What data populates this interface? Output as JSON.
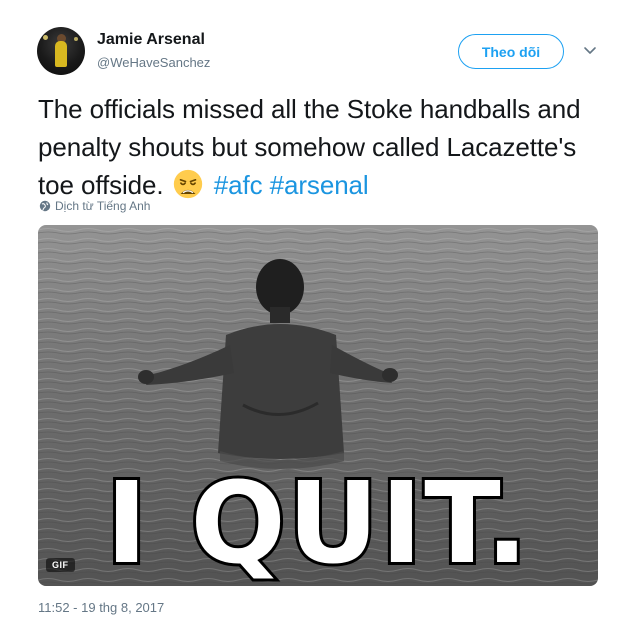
{
  "user": {
    "display_name": "Jamie Arsenal",
    "handle": "@WeHaveSanchez"
  },
  "follow_button": {
    "label": "Theo dõi"
  },
  "tweet": {
    "text_line": "The officials missed all the Stoke  handballs and penalty shouts but somehow called Lacazette's toe offside.",
    "emoji": "weary-face",
    "hashtags": [
      "#afc",
      "#arsenal"
    ]
  },
  "translate": {
    "label": "Dịch từ Tiếng Anh"
  },
  "media": {
    "caption_overlay": "I QUIT.",
    "badge": "GIF"
  },
  "timestamp": "11:52 - 19 thg 8, 2017",
  "colors": {
    "link_blue": "#1da1f2",
    "hashtag_blue": "#1b95e0",
    "muted_gray": "#657786"
  }
}
